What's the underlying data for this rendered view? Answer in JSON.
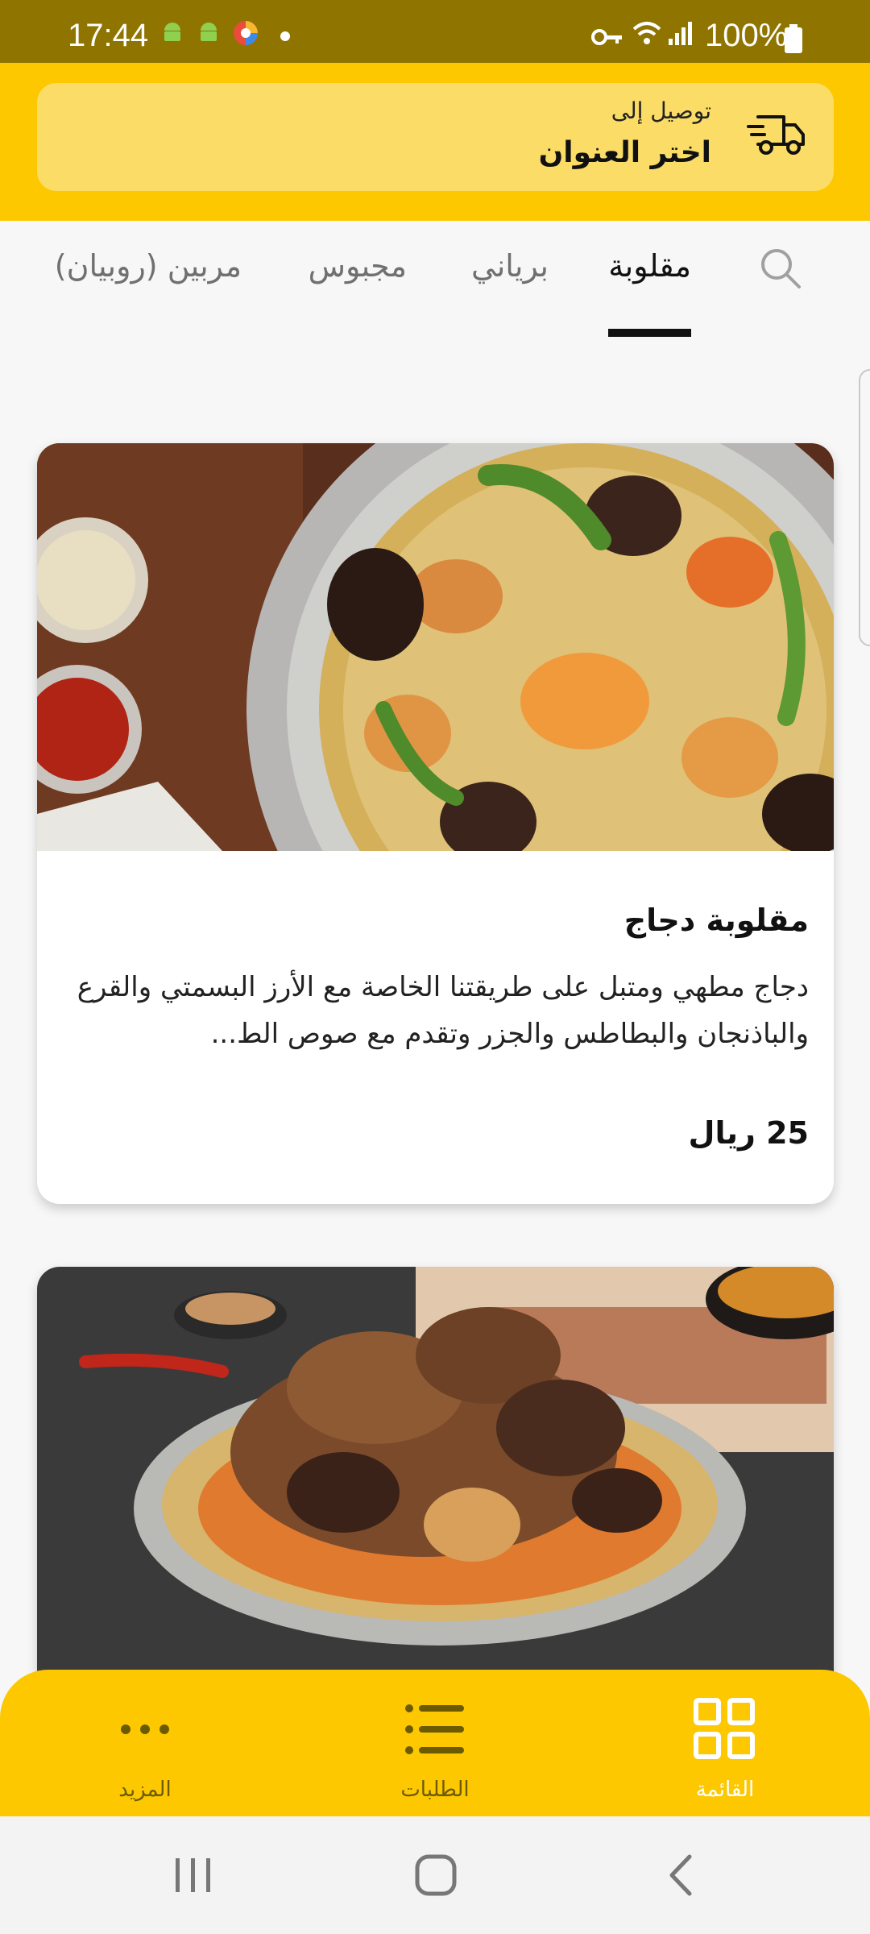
{
  "status_bar": {
    "time": "17:44",
    "battery": "100%",
    "icons": [
      "android-icon",
      "android-icon",
      "app-badge-icon",
      "dot-icon",
      "vpn-key-icon",
      "wifi-icon",
      "signal-icon",
      "battery-icon"
    ]
  },
  "header": {
    "deliver_to": "توصيل إلى",
    "address_label": "اختر العنوان",
    "icon": "delivery-truck-icon"
  },
  "tabs": [
    {
      "label": "مقلوبة",
      "active": true
    },
    {
      "label": "برياني",
      "active": false
    },
    {
      "label": "مجبوس",
      "active": false
    },
    {
      "label": "مربين (روبيان)",
      "active": false
    }
  ],
  "products": [
    {
      "title": "مقلوبة دجاج",
      "description": "دجاج  مطهي ومتبل  على طريقتنا الخاصة مع الأرز البسمتي والقرع والباذنجان والبطاطس والجزر  وتقدم مع  صوص الط...",
      "price": "25 ريال",
      "image": "chicken-maqluba-photo"
    },
    {
      "title": "",
      "description": "",
      "price": "",
      "image": "meat-maqluba-photo"
    }
  ],
  "bottom_nav": [
    {
      "label": "القائمة",
      "icon": "grid-icon",
      "active": true
    },
    {
      "label": "الطلبات",
      "icon": "list-icon",
      "active": false
    },
    {
      "label": "المزيد",
      "icon": "more-dots-icon",
      "active": false
    }
  ],
  "colors": {
    "brand_yellow": "#fdc800",
    "status_bar": "#8f7400",
    "address_card": "#fadc66",
    "nav_active": "#ffffff",
    "nav_inactive": "#6b5a00"
  }
}
